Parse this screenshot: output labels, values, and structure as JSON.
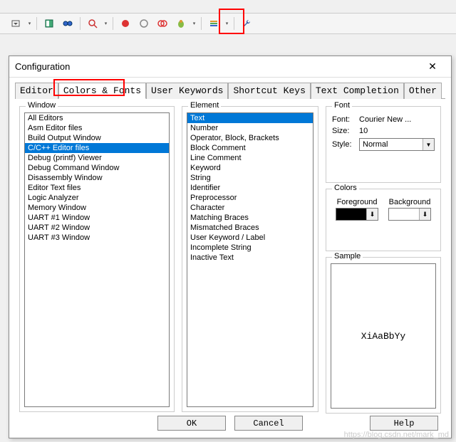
{
  "toolbar": {
    "icons": [
      "dropdown",
      "book",
      "find-binoculars",
      "zoom",
      "record-red",
      "record-outline",
      "overlap-circles",
      "bug-color",
      "list-view",
      "wrench"
    ]
  },
  "dialog": {
    "title": "Configuration",
    "tabs": [
      "Editor",
      "Colors & Fonts",
      "User Keywords",
      "Shortcut Keys",
      "Text Completion",
      "Other"
    ],
    "active_tab": 1,
    "groups": {
      "window": "Window",
      "element": "Element",
      "font": "Font",
      "colors": "Colors",
      "sample": "Sample"
    },
    "window_items": [
      "All Editors",
      "Asm Editor files",
      "Build Output Window",
      "C/C++ Editor files",
      "Debug (printf) Viewer",
      "Debug Command Window",
      "Disassembly Window",
      "Editor Text files",
      "Logic Analyzer",
      "Memory Window",
      "UART #1 Window",
      "UART #2 Window",
      "UART #3 Window"
    ],
    "window_selected": 3,
    "element_items": [
      "Text",
      "Number",
      "Operator, Block, Brackets",
      "Block Comment",
      "Line Comment",
      "Keyword",
      "String",
      "Identifier",
      "Preprocessor",
      "Character",
      "Matching Braces",
      "Mismatched Braces",
      "User Keyword / Label",
      "Incomplete String",
      "Inactive Text"
    ],
    "element_selected": 0,
    "font": {
      "font_label": "Font:",
      "font_value": "Courier New ...",
      "size_label": "Size:",
      "size_value": "10",
      "style_label": "Style:",
      "style_value": "Normal"
    },
    "colors": {
      "foreground_label": "Foreground",
      "background_label": "Background",
      "foreground_hex": "#000000",
      "background_hex": "#ffffff"
    },
    "sample_text": "XiAaBbYy",
    "buttons": {
      "ok": "OK",
      "cancel": "Cancel",
      "help": "Help"
    }
  },
  "watermark": "https://blog.csdn.net/mark_md"
}
